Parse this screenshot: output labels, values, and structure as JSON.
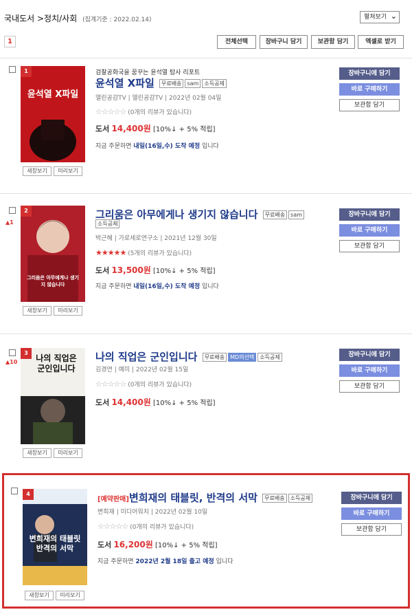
{
  "header": {
    "breadcrumb": "국내도서 >정치/사회",
    "basis": "(집계기준 : 2022.02.14)",
    "view_mode": "펼쳐보기"
  },
  "pager": {
    "current_page": "1"
  },
  "toolbar": {
    "select_all": "전체선택",
    "add_cart": "장바구니 담기",
    "add_locker": "보관함 담기",
    "export_excel": "엑셀로 받기"
  },
  "common": {
    "new_window": "새창보기",
    "preview": "미리보기",
    "cart_btn": "장바구니에 담기",
    "buy_btn": "바로 구매하기",
    "keep_btn": "보관함 담기"
  },
  "items": [
    {
      "rank": "1",
      "rank_change": "",
      "tagline": "검찰공화국을 꿈꾸는 윤석열 탐사 리포트",
      "prefix": "",
      "title": "윤석열 X파일",
      "tags": [
        "무료배송",
        "sam",
        "소득공제"
      ],
      "meta": "열린공감TV  |  열린공감TV  |  2022년 02월 04일",
      "rating_stars": 0,
      "review_text": "(0개의 리뷰가 있습니다)",
      "price_label": "도서",
      "price": "14,400원",
      "discount": "[10%↓ + 5% 적립]",
      "delivery_pre": "지금 주문하면",
      "delivery_bold": "내일(16일,수) 도착 예정",
      "delivery_post": "입니다",
      "cover_title": "윤석열 X파일",
      "cover_color": "#c0161b"
    },
    {
      "rank": "2",
      "rank_change": "▲1",
      "tagline": "",
      "prefix": "",
      "title": "그리움은 아무에게나 생기지 않습니다",
      "tags": [
        "무료배송",
        "sam"
      ],
      "tags_line2": [
        "소득공제"
      ],
      "meta": "박근혜  |  가로세로연구소  |  2021년 12월 30일",
      "rating_stars": 5,
      "review_text": "(5개의 리뷰가 있습니다)",
      "price_label": "도서",
      "price": "13,500원",
      "discount": "[10%↓ + 5% 적립]",
      "delivery_pre": "지금 주문하면",
      "delivery_bold": "내일(16일,수) 도착 예정",
      "delivery_post": "입니다",
      "cover_title": "그리움은 아무에게나 생기지 않습니다",
      "cover_color": "#b01f2a"
    },
    {
      "rank": "3",
      "rank_change": "▲10",
      "tagline": "",
      "prefix": "",
      "title": "나의 직업은 군인입니다",
      "tags": [
        "무료배송",
        "MD의선택",
        "소득공제"
      ],
      "meta": "김경연  |  예미  |  2022년 02월 15일",
      "rating_stars": 0,
      "review_text": "(0개의 리뷰가 있습니다)",
      "price_label": "도서",
      "price": "14,400원",
      "discount": "[10%↓ + 5% 적립]",
      "delivery_pre": "",
      "delivery_bold": "",
      "delivery_post": "",
      "cover_title": "나의 직업은 군인입니다",
      "cover_color": "#2a2a2a"
    },
    {
      "rank": "4",
      "rank_change": "",
      "tagline": "",
      "prefix": "[예약판매]",
      "title": "변희재의 태블릿, 반격의 서막",
      "tags": [
        "무료배송",
        "소득공제"
      ],
      "meta": "변희재  |  미디어워치  |  2022년 02월 10일",
      "rating_stars": 0,
      "review_text": "(0개의 리뷰가 있습니다)",
      "price_label": "도서",
      "price": "16,200원",
      "discount": "[10%↓ + 5% 적립]",
      "delivery_pre": "지금 주문하면",
      "delivery_bold": "2022년 2월 18일 출고 예정",
      "delivery_post": "입니다",
      "cover_title": "변희재의 태블릿 반격의 서막",
      "cover_color": "#1f2f55"
    }
  ],
  "colors": {
    "accent_red": "#d32f2f",
    "title_blue": "#1f3b8a",
    "cart_btn": "#555d8a",
    "buy_btn": "#7b8ee0"
  }
}
